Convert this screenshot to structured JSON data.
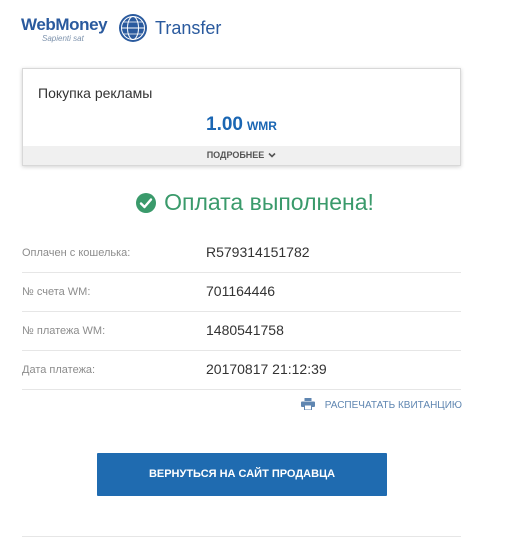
{
  "header": {
    "brand": "WebMoney",
    "brand_sub": "Sapienti sat",
    "service": "Transfer",
    "logo_icon": "webmoney-globe-icon"
  },
  "order": {
    "title": "Покупка рекламы",
    "amount": "1.00",
    "currency": "WMR",
    "details_label": "ПОДРОБНЕЕ",
    "details_icon": "chevron-down-icon"
  },
  "status": {
    "text": "Оплата выполнена!",
    "icon": "check-circle-icon",
    "color": "#3a9a6b"
  },
  "details": [
    {
      "label": "Оплачен с кошелька:",
      "value": "R579314151782"
    },
    {
      "label": "№ счета WM:",
      "value": "701164446"
    },
    {
      "label": "№ платежа WM:",
      "value": "1480541758"
    },
    {
      "label": "Дата платежа:",
      "value": "20170817 21:12:39"
    }
  ],
  "actions": {
    "print_label": "РАСПЕЧАТАТЬ КВИТАНЦИЮ",
    "print_icon": "printer-icon",
    "return_label": "ВЕРНУТЬСЯ НА САЙТ ПРОДАВЦА"
  },
  "colors": {
    "brand_blue": "#2a5a9e",
    "accent_blue": "#1f6bb0",
    "success_green": "#3a9a6b"
  }
}
